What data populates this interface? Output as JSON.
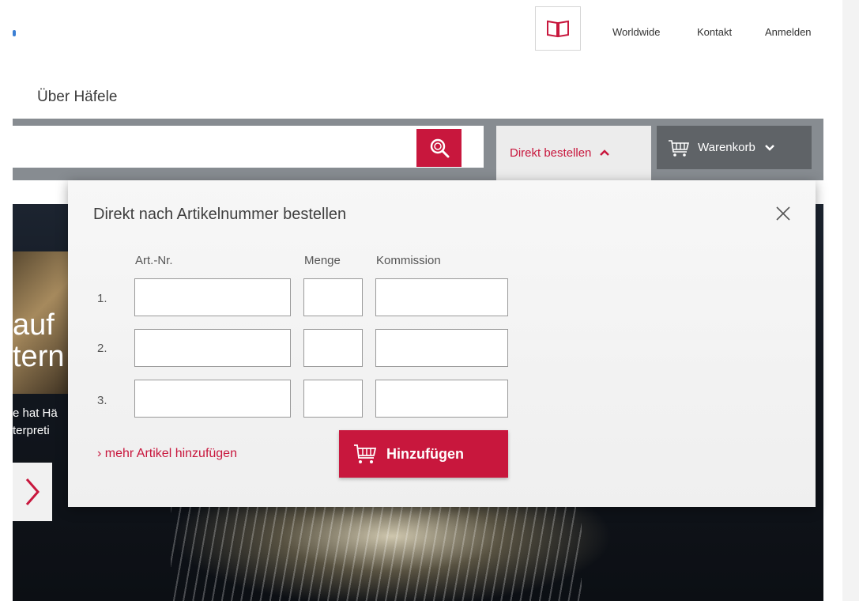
{
  "header": {
    "catalog_icon": "book-icon",
    "links": [
      "Worldwide",
      "Kontakt",
      "Anmelden"
    ]
  },
  "nav": {
    "about_label": "Über Häfele"
  },
  "search": {
    "value": "",
    "placeholder": "",
    "button_icon": "search-icon"
  },
  "tabs": {
    "direkt_label": "Direkt bestellen",
    "cart_label": "Warenkorb"
  },
  "hero": {
    "headline_line1": "auf",
    "headline_line2": "tern",
    "body_line1": "e hat Hä",
    "body_line2": "terpreti"
  },
  "popup": {
    "title": "Direkt nach Artikelnummer bestellen",
    "columns": [
      "Art.-Nr.",
      "Menge",
      "Kommission"
    ],
    "rows": [
      {
        "num": "1.",
        "art_nr": "",
        "menge": "",
        "kommission": ""
      },
      {
        "num": "2.",
        "art_nr": "",
        "menge": "",
        "kommission": ""
      },
      {
        "num": "3.",
        "art_nr": "",
        "menge": "",
        "kommission": ""
      }
    ],
    "more_link": "› mehr Artikel hinzufügen",
    "add_button": "Hinzufügen"
  },
  "colors": {
    "accent": "#c8173d",
    "band": "#878c91",
    "cart_bg": "#5f6367"
  }
}
